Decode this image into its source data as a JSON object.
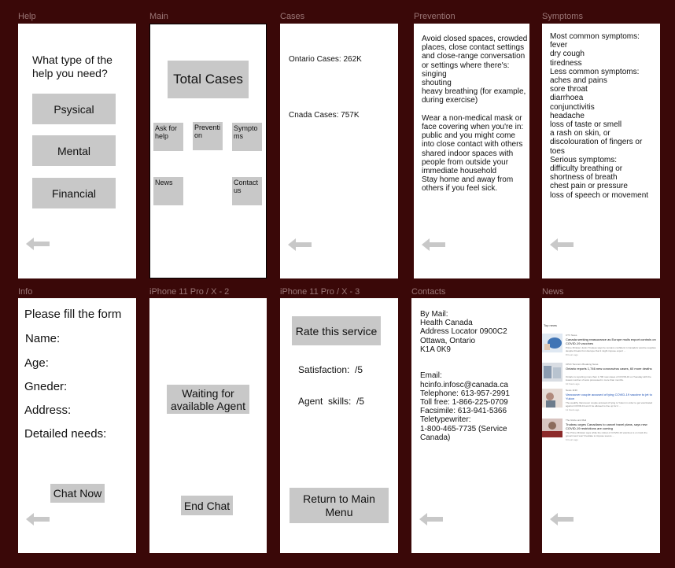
{
  "frames": {
    "help": {
      "label": "Help",
      "question": "What type of the help you need?",
      "buttons": [
        "Psysical",
        "Mental",
        "Financial"
      ]
    },
    "main": {
      "label": "Main",
      "total_cases": "Total Cases",
      "tiles": {
        "ask": "Ask for help",
        "prevention": "Preventi on",
        "symptoms": "Sympto ms",
        "news": "News",
        "contact": "Contact us"
      }
    },
    "cases": {
      "label": "Cases",
      "ontario": "Ontario Cases: 262K",
      "canada": "Cnada Cases: 757K"
    },
    "prevention": {
      "label": "Prevention",
      "lines": [
        "Avoid closed spaces, crowded",
        "places, close contact settings",
        "and close-range conversation",
        "or settings where there's:",
        "singing",
        "shouting",
        "heavy breathing (for example,",
        "during exercise)",
        "",
        "Wear a non-medical mask or",
        "face covering when you're in:",
        "public and you might come",
        "into close contact with others",
        "shared indoor spaces with",
        "people from outside your",
        "immediate household",
        "Stay home and away from",
        "others if you feel sick."
      ]
    },
    "symptoms": {
      "label": "Symptoms",
      "lines": [
        "Most common symptoms:",
        "fever",
        "dry cough",
        "tiredness",
        "Less common symptoms:",
        "aches and pains",
        "sore throat",
        "diarrhoea",
        "conjunctivitis",
        "headache",
        "loss of taste or smell",
        "a rash on skin, or",
        "discolouration of fingers or",
        "toes",
        "Serious symptoms:",
        "difficulty breathing or",
        "shortness of breath",
        "chest pain or pressure",
        "loss of speech or movement"
      ]
    },
    "info": {
      "label": "Info",
      "title": "Please fill the form",
      "fields": [
        "Name:",
        "Age:",
        "Gneder:",
        "Address:",
        "Detailed needs:"
      ],
      "chat_now": "Chat Now"
    },
    "iphone2": {
      "label": "iPhone 11 Pro / X - 2",
      "waiting": "Waiting for available Agent",
      "end_chat": "End Chat"
    },
    "iphone3": {
      "label": "iPhone 11 Pro / X - 3",
      "rate": "Rate this service",
      "satisfaction": "Satisfaction:  /5",
      "agent_skills": "Agent  skills:  /5",
      "return": "Return to Main Menu"
    },
    "contacts": {
      "label": "Contacts",
      "lines": [
        "By Mail:",
        "Health Canada",
        "Address Locator 0900C2",
        "Ottawa, Ontario",
        "K1A 0K9",
        "",
        "",
        "Email:",
        "hcinfo.infosc@canada.ca",
        "Telephone: 613-957-2991",
        "Toll free: 1-866-225-0709",
        "Facsimile: 613-941-5366",
        "Teletypewriter:",
        "1-800-465-7735 (Service",
        "Canada)"
      ]
    },
    "news": {
      "label": "News",
      "heading": "Top news",
      "items": [
        {
          "source": "CTV News",
          "title": "Canada seeking reassurance as Europe mulls export controls on COVID-19 vaccines",
          "desc": "Prime Minister Justin Trudeau says he remains confident in Canada's vaccine supplies despite threats from Europe that it might impose export ...",
          "time": "8 hours ago",
          "thumb_color": "#3f74b5"
        },
        {
          "source": "CP24 Toronto's Breaking News",
          "title": "Ontario reports 1,746 new coronavirus cases, 60 more deaths",
          "desc": "Ontario is reporting more than 1,700 new cases of COVID-19 on Tuesday with the lowest number of tests processed in more than months.",
          "time": "10 hours ago",
          "thumb_color": "#8a9bb0"
        },
        {
          "source": "News 1130",
          "title": "Vancouver couple accused of lying COVID-19 vaccine to jet to Yukon",
          "desc": "The wealthy Vancouver couple accused of lying to Yukon in order to get vaccinated against COVID-19 won't be allowed to line up for it ...",
          "time": "11 hours ago",
          "thumb_color": "#b08a7c"
        },
        {
          "source": "The Globe and Mail",
          "title": "Trudeau urges Canadians to cancel travel plans, says new COVID-19 restrictions are coming",
          "desc": "The Prime Minister says while the rollout of COVID-19 vaccines is on track the government won't hesitate to impose severe ...",
          "time": "6 hours ago",
          "thumb_color": "#8c2a2a"
        }
      ]
    }
  }
}
